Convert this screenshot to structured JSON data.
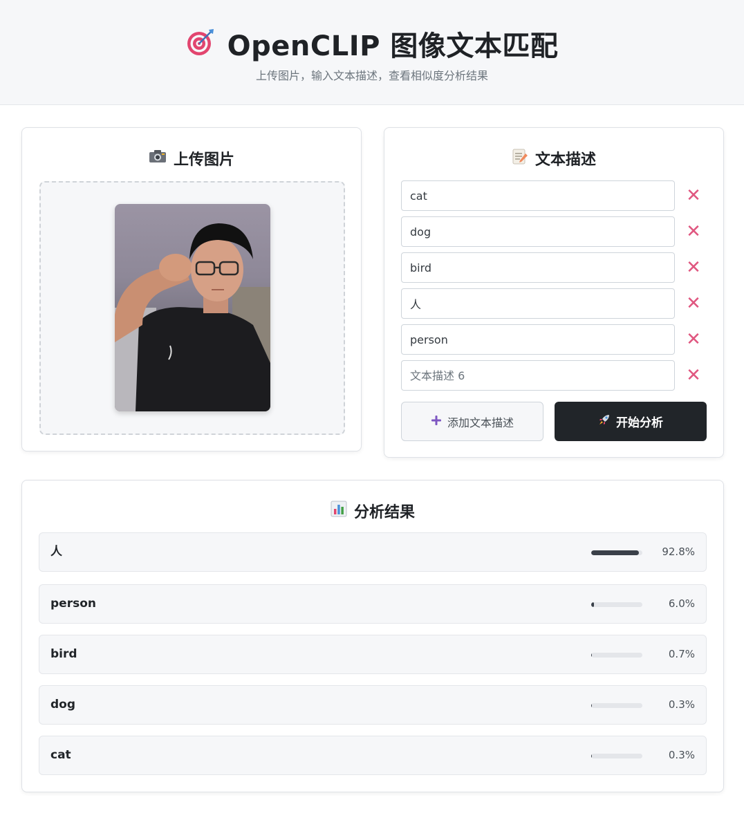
{
  "header": {
    "title": "OpenCLIP 图像文本匹配",
    "subtitle": "上传图片，输入文本描述，查看相似度分析结果",
    "icon": "target-icon"
  },
  "upload": {
    "title": "上传图片",
    "icon": "camera-icon"
  },
  "texts": {
    "title": "文本描述",
    "icon": "memo-icon",
    "items": [
      {
        "value": "cat",
        "placeholder": "文本描述 1"
      },
      {
        "value": "dog",
        "placeholder": "文本描述 2"
      },
      {
        "value": "bird",
        "placeholder": "文本描述 3"
      },
      {
        "value": "人",
        "placeholder": "文本描述 4"
      },
      {
        "value": "person",
        "placeholder": "文本描述 5"
      },
      {
        "value": "",
        "placeholder": "文本描述 6"
      }
    ],
    "delete_glyph": "✕",
    "add_label": "添加文本描述",
    "analyze_label": "开始分析"
  },
  "results": {
    "title": "分析结果",
    "icon": "bar-chart-icon",
    "items": [
      {
        "label": "人",
        "percent_text": "92.8%",
        "value": 92.8
      },
      {
        "label": "person",
        "percent_text": "6.0%",
        "value": 6.0
      },
      {
        "label": "bird",
        "percent_text": "0.7%",
        "value": 0.7
      },
      {
        "label": "dog",
        "percent_text": "0.3%",
        "value": 0.3
      },
      {
        "label": "cat",
        "percent_text": "0.3%",
        "value": 0.3
      }
    ]
  },
  "colors": {
    "accent_dark": "#212529",
    "delete": "#e05780",
    "bar": "#3a4049"
  }
}
